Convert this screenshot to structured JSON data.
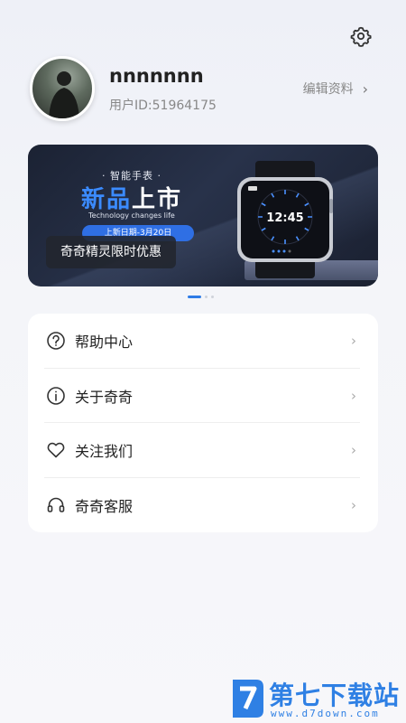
{
  "profile": {
    "username": "nnnnnnn",
    "user_id": "用户ID:51964175",
    "edit_label": "编辑资料",
    "chevron": "›"
  },
  "banner": {
    "subtitle": "· 智能手表 ·",
    "title_blue": "新品",
    "title_white": "上市",
    "english": "Technology changes life",
    "date": "上新日期-3月20日",
    "promo": "奇奇精灵限时优惠",
    "watch_time": "12:45",
    "slides": 3,
    "active_slide": 1
  },
  "menu": {
    "items": [
      {
        "label": "帮助中心",
        "icon": "question-circle-icon"
      },
      {
        "label": "关于奇奇",
        "icon": "info-circle-icon"
      },
      {
        "label": "关注我们",
        "icon": "heart-icon"
      },
      {
        "label": "奇奇客服",
        "icon": "headset-icon"
      }
    ],
    "arrow": "›"
  },
  "watermark": {
    "name": "第七下载站",
    "url": "www.d7down.com"
  },
  "colors": {
    "accent": "#2f7ce6",
    "banner_bg": "#1b2233"
  }
}
